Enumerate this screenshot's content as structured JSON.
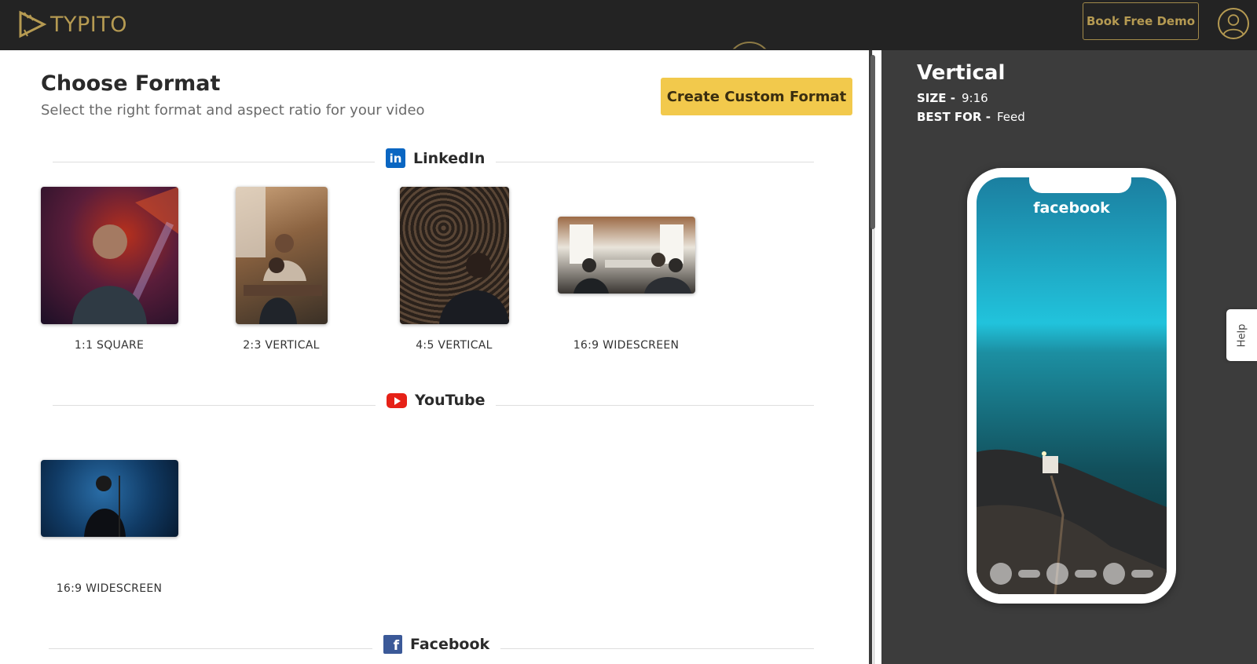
{
  "header": {
    "brand": "TYPITO",
    "demo_button": "Book Free Demo"
  },
  "page": {
    "title": "Choose Format",
    "subtitle": "Select the right format and aspect ratio for your video",
    "custom_button": "Create Custom Format"
  },
  "sections": {
    "linkedin": {
      "name": "LinkedIn",
      "formats": [
        "1:1 SQUARE",
        "2:3 VERTICAL",
        "4:5 VERTICAL",
        "16:9 WIDESCREEN"
      ]
    },
    "youtube": {
      "name": "YouTube",
      "formats": [
        "16:9 WIDESCREEN"
      ]
    },
    "facebook": {
      "name": "Facebook"
    }
  },
  "preview": {
    "title": "Vertical",
    "size_label": "SIZE -",
    "size_value": "9:16",
    "best_label": "BEST FOR -",
    "best_value": "Feed",
    "platform_word": "facebook"
  },
  "help_tab": "Help",
  "colors": {
    "accent": "#f2c94c",
    "brand_gold": "#b59a52",
    "linkedin": "#0a66c2",
    "youtube": "#e62117",
    "facebook": "#3b5998"
  }
}
